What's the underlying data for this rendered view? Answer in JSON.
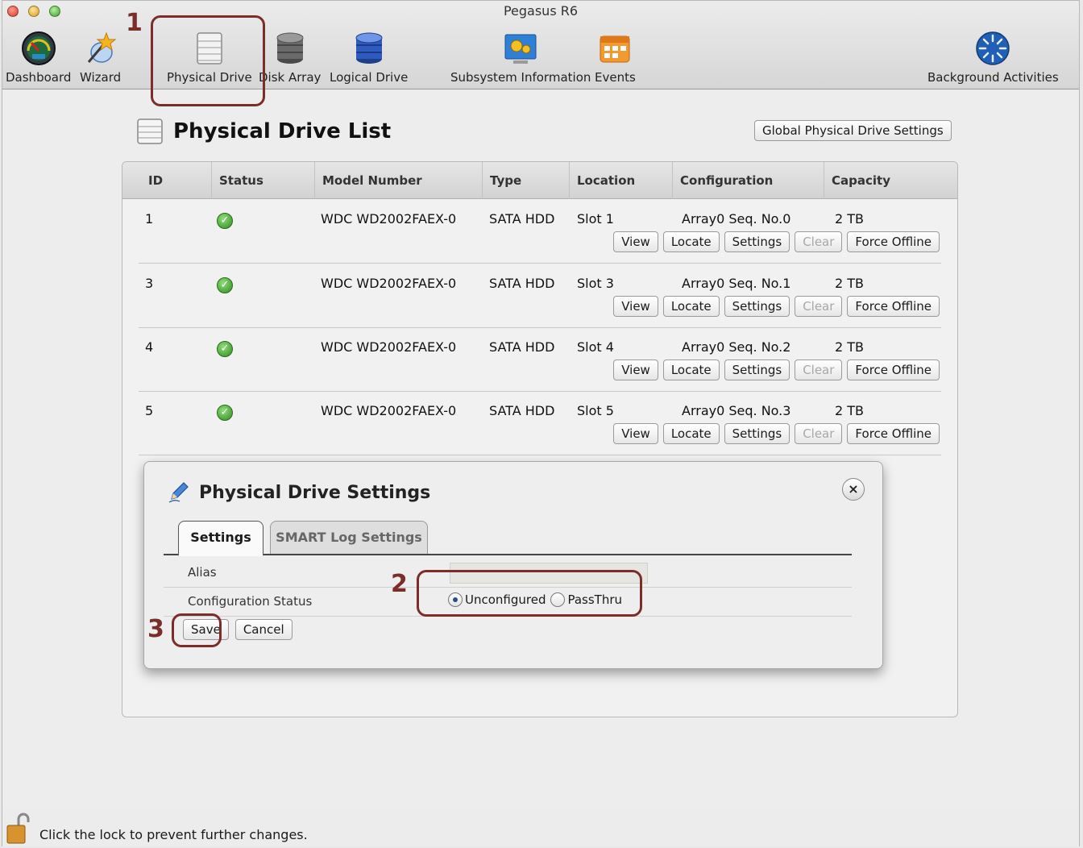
{
  "window": {
    "title": "Pegasus R6"
  },
  "toolbar": {
    "items": [
      {
        "label": "Dashboard",
        "icon": "dashboard-gauge-icon"
      },
      {
        "label": "Wizard",
        "icon": "wizard-wand-icon"
      },
      {
        "label": "Physical Drive",
        "icon": "physical-drive-icon"
      },
      {
        "label": "Disk Array",
        "icon": "disk-array-icon"
      },
      {
        "label": "Logical Drive",
        "icon": "logical-drive-icon"
      },
      {
        "label": "Subsystem Information",
        "icon": "subsystem-gears-icon"
      },
      {
        "label": "Events",
        "icon": "events-calendar-icon"
      },
      {
        "label": "Background Activities",
        "icon": "background-activities-icon"
      }
    ]
  },
  "page": {
    "title": "Physical Drive List",
    "global_settings_button": "Global Physical Drive Settings"
  },
  "table": {
    "columns": [
      "ID",
      "Status",
      "Model Number",
      "Type",
      "Location",
      "Configuration",
      "Capacity"
    ],
    "rows": [
      {
        "id": "1",
        "status": "ok",
        "model": "WDC WD2002FAEX-0",
        "type": "SATA HDD",
        "location": "Slot 1",
        "configuration": "Array0 Seq. No.0",
        "capacity": "2 TB"
      },
      {
        "id": "3",
        "status": "ok",
        "model": "WDC WD2002FAEX-0",
        "type": "SATA HDD",
        "location": "Slot 3",
        "configuration": "Array0 Seq. No.1",
        "capacity": "2 TB"
      },
      {
        "id": "4",
        "status": "ok",
        "model": "WDC WD2002FAEX-0",
        "type": "SATA HDD",
        "location": "Slot 4",
        "configuration": "Array0 Seq. No.2",
        "capacity": "2 TB"
      },
      {
        "id": "5",
        "status": "ok",
        "model": "WDC WD2002FAEX-0",
        "type": "SATA HDD",
        "location": "Slot 5",
        "configuration": "Array0 Seq. No.3",
        "capacity": "2 TB"
      }
    ],
    "row_buttons": {
      "view": "View",
      "locate": "Locate",
      "settings": "Settings",
      "clear": "Clear",
      "force_offline": "Force Offline"
    }
  },
  "dialog": {
    "title": "Physical Drive Settings",
    "close_symbol": "×",
    "tabs": [
      {
        "label": "Settings",
        "active": true
      },
      {
        "label": "SMART Log Settings",
        "active": false
      }
    ],
    "alias_label": "Alias",
    "alias_value": "",
    "config_status_label": "Configuration Status",
    "config_options": [
      {
        "label": "Unconfigured",
        "checked": true
      },
      {
        "label": "PassThru",
        "checked": false
      }
    ],
    "save_button": "Save",
    "cancel_button": "Cancel"
  },
  "callouts": [
    "1",
    "2",
    "3"
  ],
  "footer": {
    "text": "Click the lock to prevent further changes."
  },
  "colors": {
    "callout": "#7b2d2a",
    "status_ok": "#2e8a1e"
  }
}
